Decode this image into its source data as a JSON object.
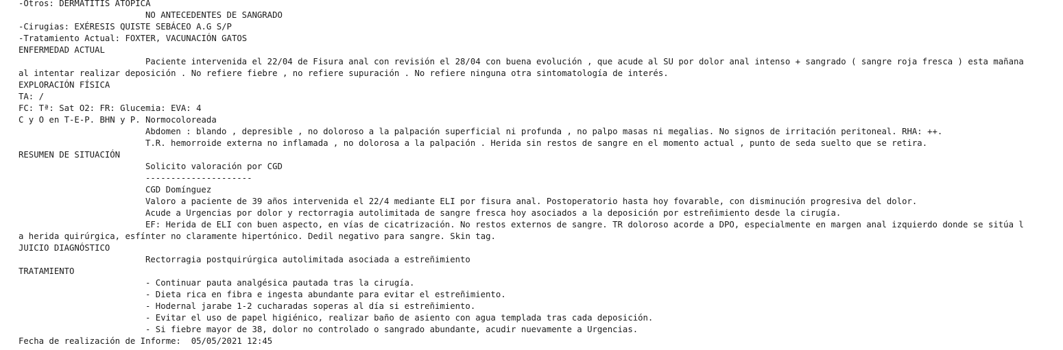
{
  "report": {
    "antecedentes": {
      "otros": "-Otros: DERMATITIS ATOPICA",
      "sangrado": "NO ANTECEDENTES DE SANGRADO",
      "cirugias": "-Cirugias: EXÉRESIS QUISTE SEBÁCEO A.G S/P",
      "tratamiento_actual": "-Tratamiento Actual: FOXTER, VACUNACIÓN GATOS"
    },
    "enfermedad_actual": {
      "heading": "ENFERMEDAD ACTUAL",
      "line1": "Paciente intervenida el 22/04 de Fisura anal con revisión el 28/04 con buena evolución , que acude al SU por dolor anal intenso + sangrado ( sangre roja fresca ) esta mañana",
      "line2": "al intentar realizar deposición . No refiere fiebre , no refiere supuración . No refiere ninguna otra sintomatología de interés."
    },
    "exploracion": {
      "heading": "EXPLORACIÓN FÍSICA",
      "ta": "TA: /",
      "vitals": "FC: Tª: Sat O2: FR: Glucemia: EVA: 4",
      "general": "C y O en T-E-P. BHN y P. Normocoloreada",
      "abdomen": "Abdomen : blando , depresible , no doloroso a la palpación superficial ni profunda , no palpo masas ni megalias. No signos de irritación peritoneal. RHA: ++.",
      "tr": "T.R. hemorroide externa no inflamada , no dolorosa a la palpación . Herida sin restos de sangre en el momento actual , punto de seda suelto que se retira."
    },
    "resumen": {
      "heading": "RESUMEN DE SITUACIÓN",
      "solicito": "Solicito valoración por CGD",
      "separator": "---------------------",
      "cgd": "CGD Domínguez",
      "valoro": "Valoro a paciente de 39 años intervenida el 22/4 mediante ELI por fisura anal. Postoperatorio hasta hoy fovarable, con disminución progresiva del dolor.",
      "acude": "Acude a Urgencias por dolor y rectorragia autolimitada de sangre fresca hoy asociados a la deposición por estreñimiento desde la cirugía.",
      "ef1": "EF: Herida de ELI con buen aspecto, en vías de cicatrización. No restos externos de sangre. TR doloroso acorde a DPO, especialmente en margen anal izquierdo donde se sitúa l",
      "ef2": "a herida quirúrgica, esfínter no claramente hipertónico. Dedil negativo para sangre. Skin tag."
    },
    "juicio": {
      "heading": "JUICIO DIAGNÓSTICO",
      "text": "Rectorragia postquirúrgica autolimitada asociada a estreñimiento"
    },
    "tratamiento": {
      "heading": "TRATAMIENTO",
      "items": [
        "- Continuar pauta analgésica pautada tras la cirugía.",
        "- Dieta rica en fibra e ingesta abundante para evitar el estreñimiento.",
        "- Hodernal jarabe 1-2 cucharadas soperas al día si estreñimiento.",
        "- Evitar el uso de papel higiénico, realizar baño de asiento con agua templada tras cada deposición.",
        "- Si fiebre mayor de 38, dolor no controlado o sangrado abundante, acudir nuevamente a Urgencias."
      ]
    },
    "fecha": "Fecha de realización de Informe:  05/05/2021 12:45"
  }
}
